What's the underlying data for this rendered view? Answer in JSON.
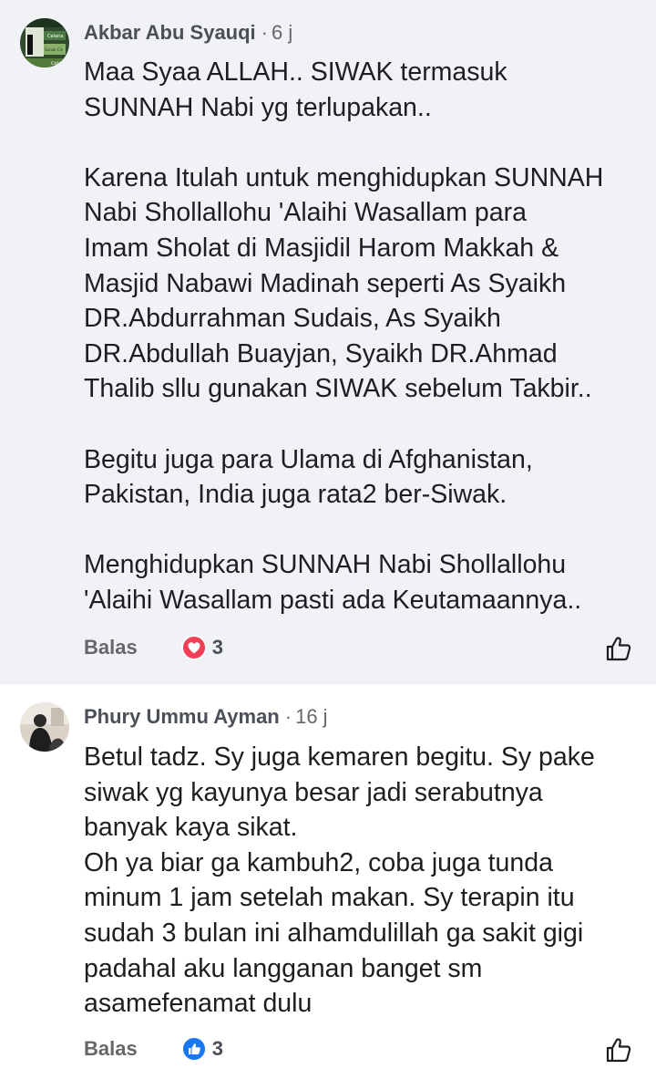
{
  "comments": [
    {
      "author": "Akbar Abu Syauqi",
      "separator": "·",
      "time": "6 j",
      "text": "Maa Syaa ALLAH.. SIWAK termasuk\nSUNNAH Nabi yg terlupakan..\n\nKarena Itulah untuk menghidupkan SUNNAH\nNabi Shollallohu 'Alaihi Wasallam  para\nImam Sholat di Masjidil Harom Makkah &\nMasjid Nabawi Madinah seperti As Syaikh\nDR.Abdurrahman Sudais, As Syaikh\nDR.Abdullah Buayjan, Syaikh DR.Ahmad\nThalib sllu gunakan SIWAK sebelum Takbir..\n\nBegitu juga para Ulama di Afghanistan,\nPakistan, India juga rata2 ber-Siwak.\n\nMenghidupkan SUNNAH Nabi Shollallohu\n'Alaihi Wasallam pasti ada Keutamaannya..",
      "reply_label": "Balas",
      "reaction_icon": "heart-icon",
      "reaction_color": "#f33e58",
      "reaction_count": "3",
      "avatar_texts": [
        "Celana",
        "Sunah Cin",
        "Cela"
      ]
    },
    {
      "author": "Phury Ummu Ayman",
      "separator": "·",
      "time": "16 j",
      "text": "Betul tadz. Sy juga kemaren begitu. Sy pake\nsiwak yg kayunya besar jadi serabutnya\nbanyak kaya sikat.\nOh ya biar ga kambuh2, coba juga tunda\nminum 1 jam setelah makan. Sy terapin itu\nsudah 3 bulan ini alhamdulillah ga sakit gigi\npadahal aku langganan banget sm\nasamefenamat dulu",
      "reply_label": "Balas",
      "reaction_icon": "like-icon",
      "reaction_color": "#1877f2",
      "reaction_count": "3"
    }
  ],
  "colors": {
    "first_comment_bg": "#f0f2f5",
    "second_comment_bg": "#ffffff",
    "secondary_text": "#65676b"
  }
}
